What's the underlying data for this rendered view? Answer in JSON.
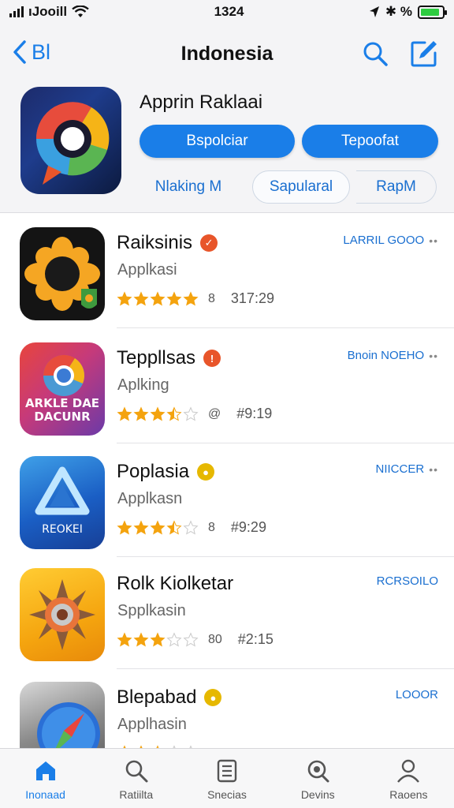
{
  "status_bar": {
    "carrier": "ıJooill",
    "time": "1324",
    "right_text": "✱ %",
    "battery_level": 0.9
  },
  "header": {
    "back_label": "Bl",
    "title": "Indonesia",
    "app_title": "Apprin Raklaai",
    "buttons": [
      "Bspolciar",
      "Tepoofat"
    ],
    "segments": [
      "Nlaking M",
      "Sapularal",
      "RapM"
    ]
  },
  "apps": [
    {
      "name": "Raiksinis",
      "subtitle": "Applkasi",
      "rating": 5,
      "rating_count": "8",
      "rating_num": "317:29",
      "action": "LARRIL GOOO",
      "badge_color": "#e8552a"
    },
    {
      "name": "Teppllsas",
      "subtitle": "Aplking",
      "rating": 3.5,
      "rating_count": "@",
      "rating_num": "#9:19",
      "action": "Bnoin  NOEHO",
      "badge_color": "#e8552a",
      "icon_text": [
        "ARKLE DAE",
        "DACUNR"
      ]
    },
    {
      "name": "Poplasia",
      "subtitle": "Applkasn",
      "rating": 3.5,
      "rating_count": "8",
      "rating_num": "#9:29",
      "action": "NIICCER",
      "badge_color": "#e6b800",
      "icon_text": [
        "REOKEI"
      ]
    },
    {
      "name": "Rolk Kiolketar",
      "subtitle": "Spplkasin",
      "rating": 3,
      "rating_count": "80",
      "rating_num": "#2:15",
      "action": "RCRSOILO",
      "badge_color": null
    },
    {
      "name": "Blepabad",
      "subtitle": "Applhasin",
      "rating": 2.5,
      "rating_count": "",
      "rating_num": "",
      "action": "LOOOR",
      "badge_color": "#e6b800"
    }
  ],
  "tabs": [
    {
      "label": "Inonaad",
      "icon": "home-icon",
      "active": true
    },
    {
      "label": "Ratiilta",
      "icon": "search-icon",
      "active": false
    },
    {
      "label": "Snecias",
      "icon": "list-icon",
      "active": false
    },
    {
      "label": "Devins",
      "icon": "magnifier-icon",
      "active": false
    },
    {
      "label": "Raoens",
      "icon": "person-icon",
      "active": false
    }
  ],
  "colors": {
    "accent": "#1a7ee8",
    "star": "#f4a30e"
  }
}
